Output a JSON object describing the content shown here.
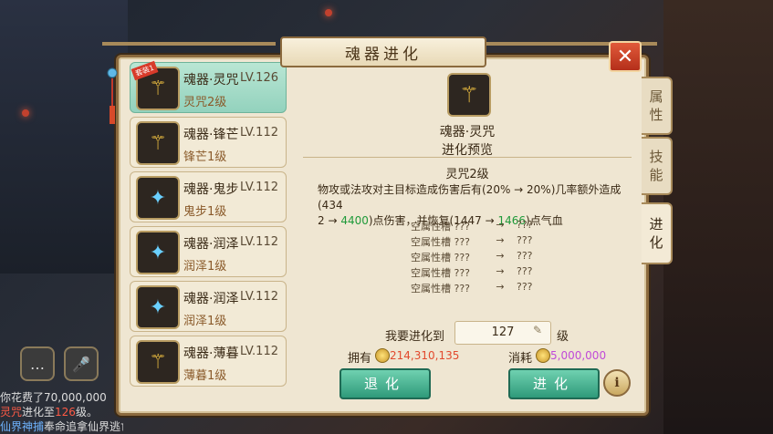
{
  "title": "魂器进化",
  "close_label": "✕",
  "list": [
    {
      "name": "魂器·灵咒",
      "level": "LV.126",
      "sub": "灵咒2级",
      "selected": true,
      "badge": "套装1",
      "icon": "gold"
    },
    {
      "name": "魂器·锋芒",
      "level": "LV.112",
      "sub": "锋芒1级",
      "selected": false,
      "icon": "gold"
    },
    {
      "name": "魂器·鬼步",
      "level": "LV.112",
      "sub": "鬼步1级",
      "selected": false,
      "icon": "blue"
    },
    {
      "name": "魂器·润泽",
      "level": "LV.112",
      "sub": "润泽1级",
      "selected": false,
      "icon": "blue"
    },
    {
      "name": "魂器·润泽",
      "level": "LV.112",
      "sub": "润泽1级",
      "selected": false,
      "icon": "blue"
    },
    {
      "name": "魂器·薄暮",
      "level": "LV.112",
      "sub": "薄暮1级",
      "selected": false,
      "icon": "gold"
    }
  ],
  "preview": {
    "name": "魂器·灵咒",
    "heading": "进化预览",
    "level_text": "灵咒2级",
    "desc_1": "物攻或法攻对主目标造成伤害后有(20% → 20%)几率额外造成(434",
    "desc_2a": "2 → ",
    "desc_2b": "4400",
    "desc_2c": ")点伤害，并恢复(1447 → ",
    "desc_2d": "1466",
    "desc_2e": ")点气血",
    "slots": [
      {
        "a": "空属性槽 ???",
        "arrow": "→",
        "b": "???"
      },
      {
        "a": "空属性槽 ???",
        "arrow": "→",
        "b": "???"
      },
      {
        "a": "空属性槽 ???",
        "arrow": "→",
        "b": "???"
      },
      {
        "a": "空属性槽 ???",
        "arrow": "→",
        "b": "???"
      },
      {
        "a": "空属性槽 ???",
        "arrow": "→",
        "b": "???"
      }
    ]
  },
  "evolve": {
    "label": "我要进化到",
    "value": "127",
    "unit": "级",
    "own_label": "拥有",
    "own_value": "214,310,135",
    "cost_label": "消耗",
    "cost_value": "5,000,000"
  },
  "buttons": {
    "back": "退化",
    "advance": "进化",
    "info": "i"
  },
  "tabs": [
    {
      "label": "属\n性",
      "active": false
    },
    {
      "label": "技\n能",
      "active": false
    },
    {
      "label": "进\n化",
      "active": true
    }
  ],
  "chat": {
    "line1a": "你花费了",
    "line1b": "70,000,000",
    "line2a": "灵咒",
    "line2b": "进化至",
    "line2c": "126",
    "line2d": "级。",
    "line3a": "仙界神捕",
    "line3b": "奉命追拿仙界逃亡人间"
  }
}
